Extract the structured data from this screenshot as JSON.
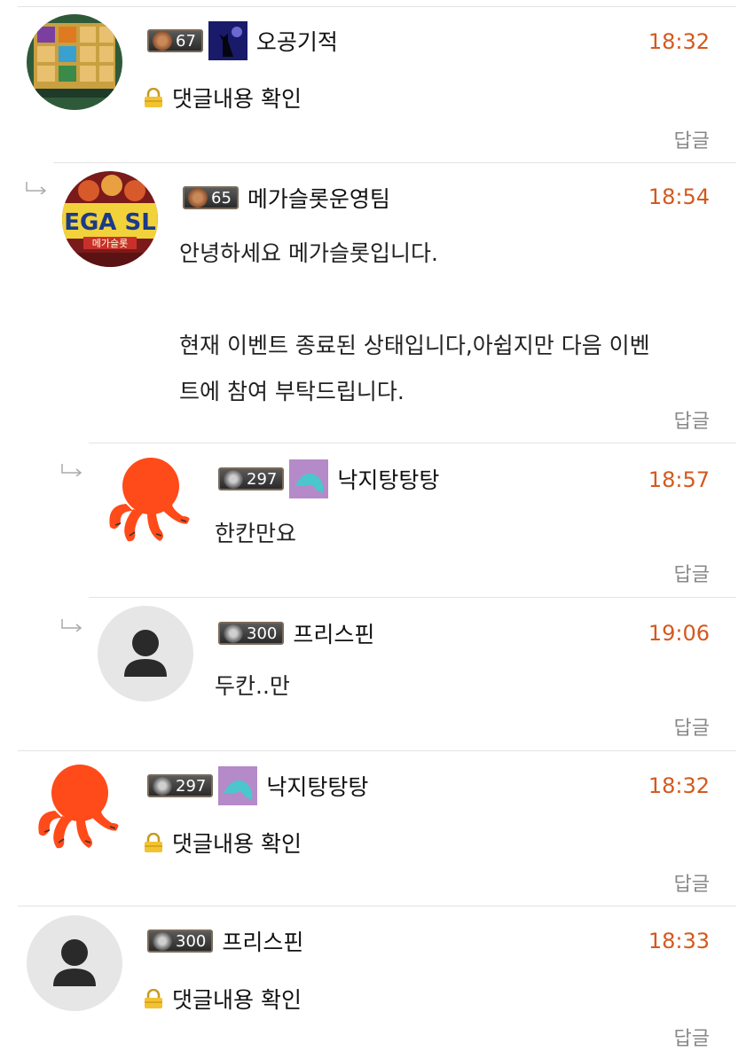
{
  "reply_label": "답글",
  "secret_text": "댓글내용 확인",
  "comments": [
    {
      "level": "67",
      "nick": "오공기적",
      "time": "18:32",
      "secret": true
    },
    {
      "level": "65",
      "nick": "메가슬롯운영팀",
      "time": "18:54",
      "lines": [
        "안녕하세요 메가슬롯입니다.",
        "",
        "현재 이벤트 종료된 상태입니다,아쉽지만 다음 이벤",
        "트에 참여 부탁드립니다."
      ]
    },
    {
      "level": "297",
      "nick": "낙지탕탕탕",
      "time": "18:57",
      "text": "한칸만요"
    },
    {
      "level": "300",
      "nick": "프리스핀",
      "time": "19:06",
      "text": "두칸..만"
    },
    {
      "level": "297",
      "nick": "낙지탕탕탕",
      "time": "18:32",
      "secret": true
    },
    {
      "level": "300",
      "nick": "프리스핀",
      "time": "18:33",
      "secret": true
    }
  ],
  "avatar_badges": {
    "mega_slot_sign": "EGA SL",
    "mega_slot_sub": "메가슬롯"
  },
  "colors": {
    "time": "#d4591e",
    "octopus": "#ff4a1a",
    "divider": "#e4e4e4"
  }
}
